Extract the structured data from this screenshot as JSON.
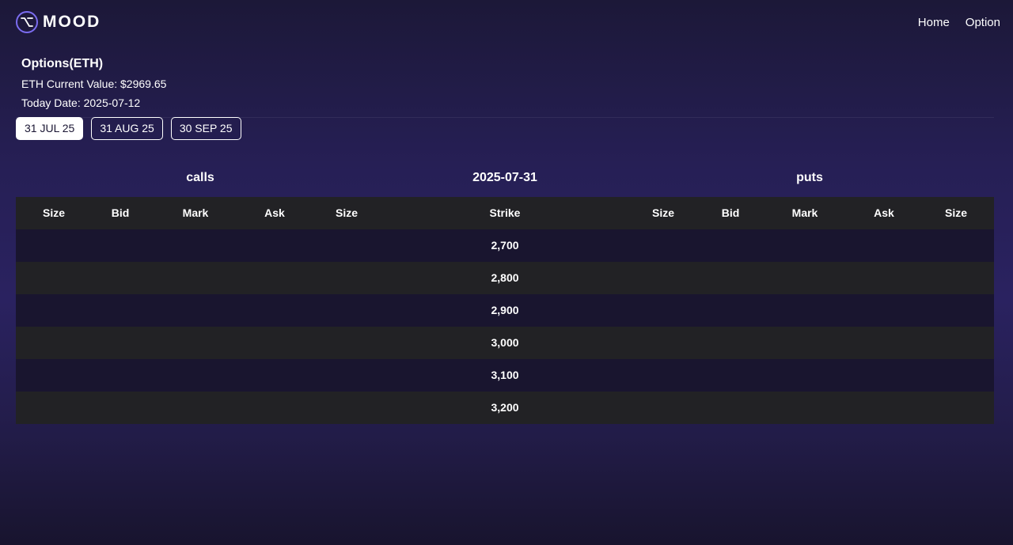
{
  "header": {
    "logo_text": "MOOD",
    "nav": [
      "Home",
      "Option"
    ]
  },
  "info": {
    "title": "Options(ETH)",
    "current_value": "ETH Current Value: $2969.65",
    "today_date": "Today Date: 2025-07-12"
  },
  "expiries": {
    "items": [
      "31 JUL 25",
      "31 AUG 25",
      "30 SEP 25"
    ],
    "selected": "31 JUL 25"
  },
  "table": {
    "calls_label": "calls",
    "date_label": "2025-07-31",
    "puts_label": "puts",
    "columns": {
      "calls": [
        "Size",
        "Bid",
        "Mark",
        "Ask",
        "Size"
      ],
      "strike": "Strike",
      "puts": [
        "Size",
        "Bid",
        "Mark",
        "Ask",
        "Size"
      ]
    },
    "strikes": [
      "2,700",
      "2,800",
      "2,900",
      "3,000",
      "3,100",
      "3,200"
    ]
  },
  "colors": {
    "accent": "#7b6cf0",
    "row_dark": "#19152f",
    "row_grey": "#222225"
  }
}
